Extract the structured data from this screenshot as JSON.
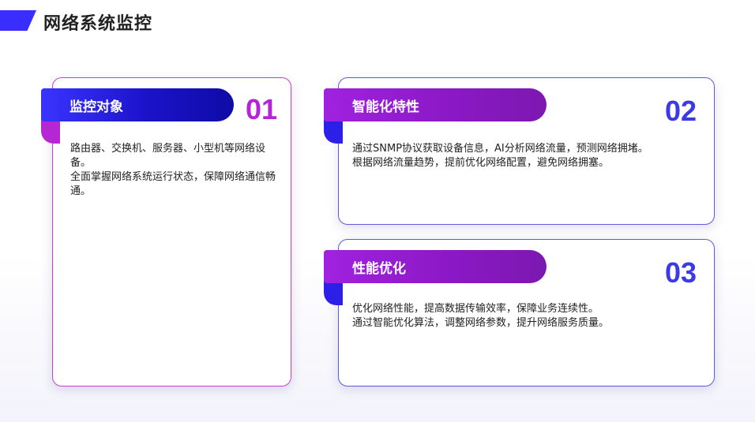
{
  "page": {
    "title": "网络系统监控"
  },
  "cards": [
    {
      "number": "01",
      "heading": "监控对象",
      "lines": [
        "路由器、交换机、服务器、小型机等网络设备。",
        "全面掌握网络系统运行状态，保障网络通信畅通。"
      ]
    },
    {
      "number": "02",
      "heading": "智能化特性",
      "lines": [
        "通过SNMP协议获取设备信息，AI分析网络流量，预测网络拥堵。",
        "根据网络流量趋势，提前优化网络配置，避免网络拥塞。"
      ]
    },
    {
      "number": "03",
      "heading": "性能优化",
      "lines": [
        "优化网络性能，提高数据传输效率，保障业务连续性。",
        "通过智能优化算法，调整网络参数，提升网络服务质量。"
      ]
    }
  ],
  "colors": {
    "accent_blue": "#3a2dff",
    "accent_purple": "#a022df",
    "card1_border": "#c93fd6",
    "card_border": "#5a5cdd"
  }
}
